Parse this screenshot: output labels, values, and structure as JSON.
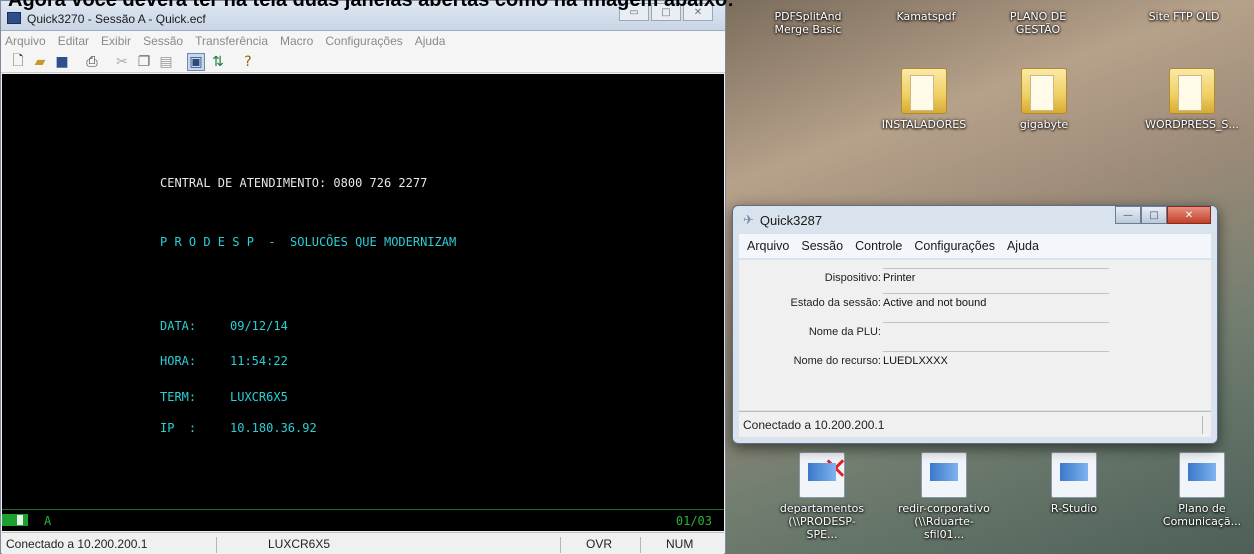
{
  "caption": "Agora você deverá ter na tela duas janelas abertas como na imagem abaixo:",
  "main_window": {
    "title": "Quick3270 - Sessão A - Quick.ecf",
    "menu": [
      "Arquivo",
      "Editar",
      "Exibir",
      "Sessão",
      "Transferência",
      "Macro",
      "Configurações",
      "Ajuda"
    ],
    "terminal": {
      "central_line": "CENTRAL DE ATENDIMENTO: 0800 726 2277",
      "slogan": "P R O D E S P  -  SOLUCÕES QUE MODERNIZAM",
      "data_label": "DATA:",
      "data_value": "09/12/14",
      "hora_label": "HORA:",
      "hora_value": "11:54:22",
      "term_label": "TERM:",
      "term_value": "LUXCR6X5",
      "ip_label": "IP  :",
      "ip_value": "10.180.36.92"
    },
    "oia": {
      "mode": "A",
      "cursor_pos": "01/03"
    },
    "status": {
      "connection": "Conectado a 10.200.200.1",
      "lu_name": "LUXCR6X5",
      "overtype": "OVR",
      "numlock": "NUM"
    }
  },
  "printer_window": {
    "title": "Quick3287",
    "menu": [
      "Arquivo",
      "Sessão",
      "Controle",
      "Configurações",
      "Ajuda"
    ],
    "fields": [
      {
        "label": "Dispositivo:",
        "value": "Printer"
      },
      {
        "label": "Estado da sessão:",
        "value": "Active and not bound"
      },
      {
        "label": "Nome da PLU:",
        "value": ""
      },
      {
        "label": "Nome do recurso:",
        "value": "LUEDLXXXX"
      }
    ],
    "status": "Conectado a 10.200.200.1"
  },
  "desktop_icons": [
    {
      "label": "PDFSplitAnd Merge Basic",
      "icon": "pdf-app-icon"
    },
    {
      "label": "Kamatspdf",
      "icon": "pdf-app-icon"
    },
    {
      "label": "PLANO DE GESTÃO",
      "icon": "document-icon"
    },
    {
      "label": "Site FTP OLD",
      "icon": "document-icon"
    },
    {
      "label": "INSTALADORES",
      "icon": "folder-icon"
    },
    {
      "label": "gigabyte",
      "icon": "folder-icon"
    },
    {
      "label": "WORDPRESS_S...",
      "icon": "folder-icon"
    },
    {
      "label": "departamentos (\\\\PRODESP-SPE...",
      "icon": "network-drive-icon"
    },
    {
      "label": "redir-corporativo (\\\\Rduarte-sfil01...",
      "icon": "network-drive-icon"
    },
    {
      "label": "R-Studio",
      "icon": "r-studio-icon"
    },
    {
      "label": "Plano de Comunicaçã...",
      "icon": "presentation-icon"
    }
  ]
}
